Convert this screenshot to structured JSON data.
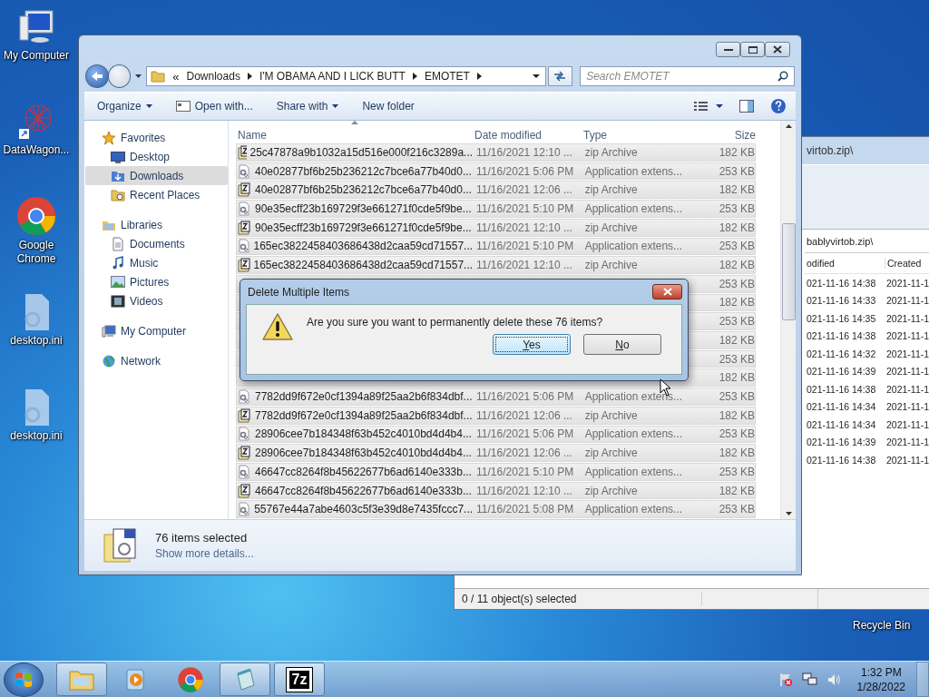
{
  "desktop_icons": [
    {
      "label": "My Computer",
      "kind": "computer"
    },
    {
      "label": "DataWagon...",
      "kind": "datawagon"
    },
    {
      "label": "Google Chrome",
      "kind": "chrome"
    },
    {
      "label": "desktop.ini",
      "kind": "ini"
    },
    {
      "label": "desktop.ini",
      "kind": "ini"
    }
  ],
  "recycle_bin": {
    "label": "Recycle Bin"
  },
  "archive_window": {
    "title": "virtob.zip\\",
    "path": "bablyvirtob.zip\\",
    "columns": [
      "odified",
      "Created"
    ],
    "rows": [
      {
        "modified": "021-11-16 14:38",
        "created": "2021-11-1"
      },
      {
        "modified": "021-11-16 14:33",
        "created": "2021-11-1"
      },
      {
        "modified": "021-11-16 14:35",
        "created": "2021-11-1"
      },
      {
        "modified": "021-11-16 14:38",
        "created": "2021-11-1"
      },
      {
        "modified": "021-11-16 14:32",
        "created": "2021-11-1"
      },
      {
        "modified": "021-11-16 14:39",
        "created": "2021-11-1"
      },
      {
        "modified": "021-11-16 14:38",
        "created": "2021-11-1"
      },
      {
        "modified": "021-11-16 14:34",
        "created": "2021-11-1"
      },
      {
        "modified": "021-11-16 14:34",
        "created": "2021-11-1"
      },
      {
        "modified": "021-11-16 14:39",
        "created": "2021-11-1"
      },
      {
        "modified": "021-11-16 14:38",
        "created": "2021-11-1"
      }
    ],
    "status": "0 / 11 object(s) selected"
  },
  "explorer": {
    "breadcrumb_overflow": "«",
    "breadcrumb": [
      "Downloads",
      "I'M OBAMA AND I LICK BUTT",
      "EMOTET"
    ],
    "search": {
      "placeholder": "Search EMOTET"
    },
    "toolbar": [
      {
        "label": "Organize",
        "dropdown": true,
        "icon": false
      },
      {
        "label": "Open with...",
        "dropdown": false,
        "icon": true
      },
      {
        "label": "Share with",
        "dropdown": true,
        "icon": false
      },
      {
        "label": "New folder",
        "dropdown": false,
        "icon": false
      }
    ],
    "nav": [
      {
        "label": "Favorites",
        "kind": "star",
        "selected": false,
        "children": [
          {
            "label": "Desktop",
            "kind": "desktop",
            "selected": false
          },
          {
            "label": "Downloads",
            "kind": "downloads",
            "selected": true
          },
          {
            "label": "Recent Places",
            "kind": "recent",
            "selected": false
          }
        ]
      },
      {
        "label": "Libraries",
        "kind": "library",
        "selected": false,
        "children": [
          {
            "label": "Documents",
            "kind": "documents",
            "selected": false
          },
          {
            "label": "Music",
            "kind": "music",
            "selected": false
          },
          {
            "label": "Pictures",
            "kind": "pictures",
            "selected": false
          },
          {
            "label": "Videos",
            "kind": "videos",
            "selected": false
          }
        ]
      },
      {
        "label": "My Computer",
        "kind": "computer",
        "selected": false
      },
      {
        "label": "Network",
        "kind": "network",
        "selected": false
      }
    ],
    "columns": [
      {
        "label": "Name",
        "sorted": true
      },
      {
        "label": "Date modified",
        "sorted": false
      },
      {
        "label": "Type",
        "sorted": false
      },
      {
        "label": "Size",
        "sorted": false
      }
    ],
    "rows": [
      {
        "kind": "zip",
        "name": "25c47878a9b1032a15d516e000f216c3289a...",
        "date": "11/16/2021 12:10 ...",
        "type": "zip Archive",
        "size": "182 KB",
        "selected": true
      },
      {
        "kind": "dll",
        "name": "40e02877bf6b25b236212c7bce6a77b40d0...",
        "date": "11/16/2021 5:06 PM",
        "type": "Application extens...",
        "size": "253 KB",
        "selected": true
      },
      {
        "kind": "zip",
        "name": "40e02877bf6b25b236212c7bce6a77b40d0...",
        "date": "11/16/2021 12:06 ...",
        "type": "zip Archive",
        "size": "182 KB",
        "selected": true
      },
      {
        "kind": "dll",
        "name": "90e35ecff23b169729f3e661271f0cde5f9be...",
        "date": "11/16/2021 5:10 PM",
        "type": "Application extens...",
        "size": "253 KB",
        "selected": true
      },
      {
        "kind": "zip",
        "name": "90e35ecff23b169729f3e661271f0cde5f9be...",
        "date": "11/16/2021 12:10 ...",
        "type": "zip Archive",
        "size": "182 KB",
        "selected": true
      },
      {
        "kind": "dll",
        "name": "165ec3822458403686438d2caa59cd71557...",
        "date": "11/16/2021 5:10 PM",
        "type": "Application extens...",
        "size": "253 KB",
        "selected": true
      },
      {
        "kind": "zip",
        "name": "165ec3822458403686438d2caa59cd71557...",
        "date": "11/16/2021 12:10 ...",
        "type": "zip Archive",
        "size": "182 KB",
        "selected": true
      },
      {
        "size": "253 KB",
        "selected": true
      },
      {
        "size": "182 KB",
        "selected": true
      },
      {
        "size": "253 KB",
        "selected": true
      },
      {
        "size": "182 KB",
        "selected": true
      },
      {
        "size": "253 KB",
        "selected": true
      },
      {
        "size": "182 KB",
        "selected": true
      },
      {
        "kind": "dll",
        "name": "7782dd9f672e0cf1394a89f25aa2b6f834dbf...",
        "date": "11/16/2021 5:06 PM",
        "type": "Application extens...",
        "size": "253 KB",
        "selected": true
      },
      {
        "kind": "zip",
        "name": "7782dd9f672e0cf1394a89f25aa2b6f834dbf...",
        "date": "11/16/2021 12:06 ...",
        "type": "zip Archive",
        "size": "182 KB",
        "selected": true
      },
      {
        "kind": "dll",
        "name": "28906cee7b184348f63b452c4010bd4d4b4...",
        "date": "11/16/2021 5:06 PM",
        "type": "Application extens...",
        "size": "253 KB",
        "selected": true
      },
      {
        "kind": "zip",
        "name": "28906cee7b184348f63b452c4010bd4d4b4...",
        "date": "11/16/2021 12:06 ...",
        "type": "zip Archive",
        "size": "182 KB",
        "selected": true
      },
      {
        "kind": "dll",
        "name": "46647cc8264f8b45622677b6ad6140e333b...",
        "date": "11/16/2021 5:10 PM",
        "type": "Application extens...",
        "size": "253 KB",
        "selected": true
      },
      {
        "kind": "zip",
        "name": "46647cc8264f8b45622677b6ad6140e333b...",
        "date": "11/16/2021 12:10 ...",
        "type": "zip Archive",
        "size": "182 KB",
        "selected": true
      },
      {
        "kind": "dll",
        "name": "55767e44a7abe4603c5f3e39d8e7435fccc7...",
        "date": "11/16/2021 5:08 PM",
        "type": "Application extens...",
        "size": "253 KB",
        "selected": true
      }
    ],
    "details": {
      "count": "76 items selected",
      "link": "Show more details..."
    }
  },
  "dialog": {
    "title": "Delete Multiple Items",
    "message": "Are you sure you want to permanently delete these 76 items?",
    "buttons": [
      {
        "label": "Yes",
        "default": true
      },
      {
        "label": "No",
        "default": false
      }
    ]
  },
  "taskbar": {
    "apps": [
      {
        "kind": "explorer",
        "running": true
      },
      {
        "kind": "media",
        "running": false
      },
      {
        "kind": "chrome",
        "running": false
      },
      {
        "kind": "notepad",
        "running": true
      },
      {
        "kind": "sevenzip",
        "running": true,
        "label": "7z"
      }
    ],
    "time": "1:32 PM",
    "date": "1/28/2022"
  }
}
